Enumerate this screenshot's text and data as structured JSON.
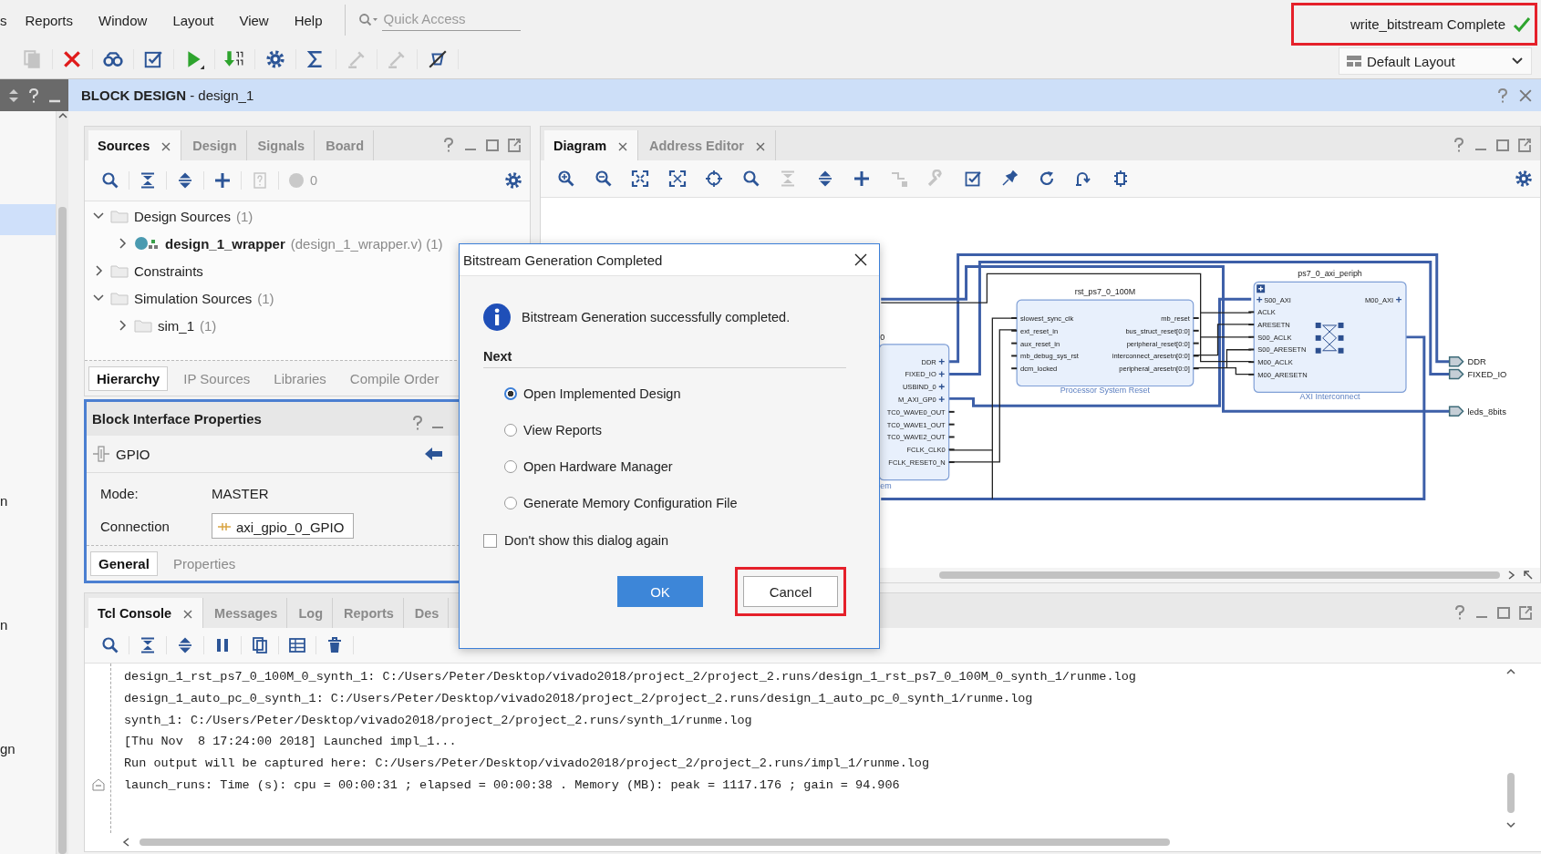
{
  "menu_bar": {
    "items": [
      {
        "label": "s"
      },
      {
        "label": "Reports"
      },
      {
        "label": "Window"
      },
      {
        "label": "Layout"
      },
      {
        "label": "View"
      },
      {
        "label": "Help"
      }
    ],
    "quick_access": {
      "placeholder": "Quick Access"
    }
  },
  "status": {
    "text": "write_bitstream Complete",
    "complete": true,
    "highlighted": true
  },
  "toolbar": [
    {
      "kind": "copy",
      "disabled": true
    },
    {
      "kind": "delete",
      "disabled": false
    },
    {
      "kind": "binoculars",
      "disabled": false
    },
    {
      "kind": "validate",
      "disabled": false
    },
    {
      "kind": "run",
      "disabled": false
    },
    {
      "kind": "download",
      "disabled": false
    },
    {
      "kind": "gear",
      "disabled": false
    },
    {
      "kind": "sigma",
      "disabled": false
    },
    {
      "kind": "pencil",
      "disabled": true
    },
    {
      "kind": "probe",
      "disabled": true
    },
    {
      "kind": "crossed",
      "disabled": false
    }
  ],
  "layout_selector": {
    "value": "Default Layout"
  },
  "left_strip": {
    "rows": [
      {
        "selected": true
      },
      {
        "text": "n",
        "selected": false
      },
      {
        "text": "n",
        "selected": false
      },
      {
        "text": "gn",
        "selected": false
      }
    ]
  },
  "block_design": {
    "title": "**BLOCK DESIGN** - design_1"
  },
  "sources": {
    "tabs": [
      {
        "label": "Sources",
        "selected": true,
        "closable": true
      },
      {
        "label": "Design",
        "selected": false,
        "closable": false
      },
      {
        "label": "Signals",
        "selected": false,
        "closable": false
      },
      {
        "label": "Board",
        "selected": false,
        "closable": false
      }
    ],
    "toolbar": [
      {
        "kind": "search",
        "disabled": false
      },
      {
        "kind": "collapse",
        "disabled": false
      },
      {
        "kind": "expand",
        "disabled": false
      },
      {
        "kind": "add",
        "disabled": false
      },
      {
        "kind": "doc",
        "disabled": true
      }
    ],
    "issue_count": "0",
    "tree": [
      {
        "name": "Design Sources",
        "detail": "(1)",
        "kind": "folder",
        "expanded": true,
        "children": [
          {
            "name": "design_1_wrapper",
            "detail": "(design_1_wrapper.v) (1)",
            "kind": "top_module",
            "expanded": false
          }
        ]
      },
      {
        "name": "Constraints",
        "kind": "folder",
        "expanded": false
      },
      {
        "name": "Simulation Sources",
        "detail": "(1)",
        "kind": "folder",
        "expanded": true,
        "children": [
          {
            "name": "sim_1",
            "detail": "(1)",
            "kind": "folder",
            "expanded": false
          }
        ]
      }
    ],
    "view_tabs": [
      {
        "label": "Hierarchy",
        "selected": true
      },
      {
        "label": "IP Sources",
        "selected": false
      },
      {
        "label": "Libraries",
        "selected": false
      },
      {
        "label": "Compile Order",
        "selected": false
      }
    ]
  },
  "block_interface_properties": {
    "title": "Block Interface Properties",
    "interface": "GPIO",
    "fields": [
      {
        "label": "Mode:",
        "value": "MASTER",
        "kind": "text"
      },
      {
        "label": "Connection",
        "value": "axi_gpio_0_GPIO",
        "kind": "net"
      }
    ],
    "tabs": [
      {
        "label": "General",
        "selected": true
      },
      {
        "label": "Properties",
        "selected": false
      }
    ]
  },
  "diagram": {
    "tabs": [
      {
        "label": "Diagram",
        "selected": true
      },
      {
        "label": "Address Editor",
        "selected": false
      }
    ],
    "toolbar": [
      {
        "kind": "zoom_in",
        "disabled": false
      },
      {
        "kind": "zoom_out",
        "disabled": false
      },
      {
        "kind": "fit",
        "disabled": false
      },
      {
        "kind": "fit_selection",
        "disabled": false
      },
      {
        "kind": "crosshair",
        "disabled": false
      },
      {
        "kind": "search",
        "disabled": false
      },
      {
        "kind": "collapse",
        "disabled": true
      },
      {
        "kind": "expand",
        "disabled": false
      },
      {
        "kind": "add",
        "disabled": false
      },
      {
        "kind": "route",
        "disabled": true
      },
      {
        "kind": "wrench",
        "disabled": true
      },
      {
        "kind": "validate",
        "disabled": false
      },
      {
        "kind": "pin",
        "disabled": false
      },
      {
        "kind": "refresh",
        "disabled": false
      },
      {
        "kind": "regenerate",
        "disabled": false
      },
      {
        "kind": "chip",
        "disabled": false
      }
    ],
    "blocks": [
      {
        "kind": "zynq",
        "title": "0",
        "subtitle": "em",
        "right_pins": [
          {
            "name": "DDR",
            "kind": "bus"
          },
          {
            "name": "FIXED_IO",
            "kind": "bus"
          },
          {
            "name": "USBIND_0",
            "kind": "bus"
          },
          {
            "name": "M_AXI_GP0",
            "kind": "bus"
          },
          {
            "name": "TC0_WAVE0_OUT",
            "kind": "net"
          },
          {
            "name": "TC0_WAVE1_OUT",
            "kind": "net"
          },
          {
            "name": "TC0_WAVE2_OUT",
            "kind": "net"
          },
          {
            "name": "FCLK_CLK0",
            "kind": "net"
          },
          {
            "name": "FCLK_RESET0_N",
            "kind": "net"
          }
        ]
      },
      {
        "kind": "reset",
        "title": "rst_ps7_0_100M",
        "subtitle": "Processor System Reset",
        "left_pins": [
          {
            "name": "slowest_sync_clk",
            "kind": "net"
          },
          {
            "name": "ext_reset_in",
            "kind": "net"
          },
          {
            "name": "aux_reset_in",
            "kind": "net"
          },
          {
            "name": "mb_debug_sys_rst",
            "kind": "net"
          },
          {
            "name": "dcm_locked",
            "kind": "net"
          }
        ],
        "right_pins": [
          {
            "name": "mb_reset",
            "kind": "net"
          },
          {
            "name": "bus_struct_reset[0:0]",
            "kind": "net"
          },
          {
            "name": "peripheral_reset[0:0]",
            "kind": "net"
          },
          {
            "name": "interconnect_aresetn[0:0]",
            "kind": "net"
          },
          {
            "name": "peripheral_aresetn[0:0]",
            "kind": "net"
          }
        ]
      },
      {
        "kind": "interconnect",
        "title": "ps7_0_axi_periph",
        "subtitle": "AXI Interconnect",
        "left_pins": [
          {
            "name": "S00_AXI",
            "kind": "bus"
          },
          {
            "name": "ACLK",
            "kind": "net"
          },
          {
            "name": "ARESETN",
            "kind": "net"
          },
          {
            "name": "S00_ACLK",
            "kind": "net"
          },
          {
            "name": "S00_ARESETN",
            "kind": "net"
          },
          {
            "name": "M00_ACLK",
            "kind": "net"
          },
          {
            "name": "M00_ARESETN",
            "kind": "net"
          }
        ],
        "right_pins": [
          {
            "name": "M00_AXI",
            "kind": "bus"
          }
        ]
      }
    ],
    "ports": [
      {
        "name": "DDR"
      },
      {
        "name": "FIXED_IO"
      },
      {
        "name": "leds_8bits"
      }
    ]
  },
  "tcl_console": {
    "tabs": [
      {
        "label": "Tcl Console",
        "selected": true,
        "closable": true
      },
      {
        "label": "Messages",
        "selected": false,
        "closable": false
      },
      {
        "label": "Log",
        "selected": false,
        "closable": false
      },
      {
        "label": "Reports",
        "selected": false,
        "closable": false
      },
      {
        "label": "Des",
        "selected": false,
        "closable": false
      }
    ],
    "toolbar": [
      {
        "kind": "search",
        "disabled": false
      },
      {
        "kind": "collapse",
        "disabled": false
      },
      {
        "kind": "expand",
        "disabled": false
      },
      {
        "kind": "pause",
        "disabled": false
      },
      {
        "kind": "copy_doc",
        "disabled": false
      },
      {
        "kind": "table",
        "disabled": false
      },
      {
        "kind": "trash",
        "disabled": false
      }
    ],
    "lines": [
      {
        "text": "design_1_rst_ps7_0_100M_0_synth_1: C:/Users/Peter/Desktop/vivado2018/project_2/project_2.runs/design_1_rst_ps7_0_100M_0_synth_1/runme.log",
        "collapsible": false
      },
      {
        "text": "design_1_auto_pc_0_synth_1: C:/Users/Peter/Desktop/vivado2018/project_2/project_2.runs/design_1_auto_pc_0_synth_1/runme.log",
        "collapsible": false
      },
      {
        "text": "synth_1: C:/Users/Peter/Desktop/vivado2018/project_2/project_2.runs/synth_1/runme.log",
        "collapsible": false
      },
      {
        "text": "[Thu Nov  8 17:24:00 2018] Launched impl_1...",
        "collapsible": false
      },
      {
        "text": "Run output will be captured here: C:/Users/Peter/Desktop/vivado2018/project_2/project_2.runs/impl_1/runme.log",
        "collapsible": false
      },
      {
        "text": "launch_runs: Time (s): cpu = 00:00:31 ; elapsed = 00:00:38 . Memory (MB): peak = 1117.176 ; gain = 94.906",
        "collapsible": true
      }
    ]
  },
  "dialog": {
    "title": "Bitstream Generation Completed",
    "message": "Bitstream Generation successfully completed.",
    "section": "Next",
    "options": [
      {
        "label": "Open Implemented Design",
        "selected": true
      },
      {
        "label": "View Reports",
        "selected": false
      },
      {
        "label": "Open Hardware Manager",
        "selected": false
      },
      {
        "label": "Generate Memory Configuration File",
        "selected": false
      }
    ],
    "dont_show": {
      "label": "Don't show this dialog again",
      "checked": false
    },
    "buttons": [
      {
        "label": "OK",
        "kind": "primary",
        "highlighted": false
      },
      {
        "label": "Cancel",
        "kind": "secondary",
        "highlighted": true
      }
    ]
  }
}
